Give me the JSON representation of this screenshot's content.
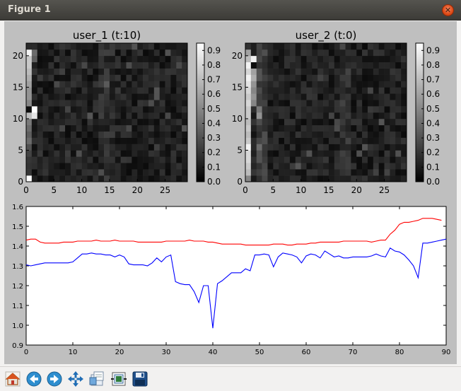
{
  "window": {
    "title": "Figure 1"
  },
  "toolbar": {
    "buttons": [
      {
        "name": "home-icon"
      },
      {
        "name": "back-icon"
      },
      {
        "name": "forward-icon"
      },
      {
        "name": "pan-icon"
      },
      {
        "name": "zoom-icon"
      },
      {
        "name": "configure-subplots-icon"
      },
      {
        "name": "save-icon"
      }
    ]
  },
  "chart_data": [
    {
      "type": "heatmap",
      "title": "user_1 (t:10)",
      "rows": 22,
      "cols": 29,
      "colormap": "gray",
      "xticks": [
        "0",
        "5",
        "10",
        "15",
        "20",
        "25"
      ],
      "yticks": [
        "0",
        "5",
        "10",
        "15",
        "20"
      ],
      "colorbar": {
        "ticks": [
          "0.0",
          "0.1",
          "0.2",
          "0.3",
          "0.4",
          "0.5",
          "0.6",
          "0.7",
          "0.8",
          "0.9"
        ],
        "range": [
          0,
          0.95
        ]
      },
      "salient_cells": [
        {
          "x": 0,
          "y": 20,
          "value": 0.9
        },
        {
          "x": 0,
          "y": 19,
          "value": 0.75
        },
        {
          "x": 0,
          "y": 18,
          "value": 0.75
        },
        {
          "x": 0,
          "y": 17,
          "value": 0.7
        },
        {
          "x": 0,
          "y": 16,
          "value": 0.65
        },
        {
          "x": 0,
          "y": 15,
          "value": 0.6
        },
        {
          "x": 0,
          "y": 14,
          "value": 0.55
        },
        {
          "x": 0,
          "y": 13,
          "value": 0.55
        },
        {
          "x": 0,
          "y": 12,
          "value": 0.5
        },
        {
          "x": 0,
          "y": 11,
          "value": 0.05
        },
        {
          "x": 1,
          "y": 11,
          "value": 0.95
        },
        {
          "x": 0,
          "y": 10,
          "value": 0.7
        },
        {
          "x": 1,
          "y": 10,
          "value": 0.85
        },
        {
          "x": 0,
          "y": 9,
          "value": 0.45
        },
        {
          "x": 0,
          "y": 8,
          "value": 0.4
        },
        {
          "x": 0,
          "y": 7,
          "value": 0.35
        },
        {
          "x": 0,
          "y": 6,
          "value": 0.4
        },
        {
          "x": 0,
          "y": 5,
          "value": 0.3
        },
        {
          "x": 0,
          "y": 4,
          "value": 0.25
        },
        {
          "x": 0,
          "y": 3,
          "value": 0.2
        },
        {
          "x": 0,
          "y": 1,
          "value": 0.2
        },
        {
          "x": 0,
          "y": 0,
          "value": 0.95
        },
        {
          "x": 1,
          "y": 20,
          "value": 0.4
        },
        {
          "x": 1,
          "y": 19,
          "value": 0.35
        }
      ]
    },
    {
      "type": "heatmap",
      "title": "user_2 (t:0)",
      "rows": 22,
      "cols": 29,
      "colormap": "gray",
      "xticks": [
        "0",
        "5",
        "10",
        "15",
        "20",
        "25"
      ],
      "yticks": [
        "0",
        "5",
        "10",
        "15",
        "20"
      ],
      "colorbar": {
        "ticks": [
          "0.0",
          "0.1",
          "0.2",
          "0.3",
          "0.4",
          "0.5",
          "0.6",
          "0.7",
          "0.8",
          "0.9"
        ],
        "range": [
          0,
          0.95
        ]
      },
      "salient_cells": [
        {
          "x": 0,
          "y": 20,
          "value": 0.6
        },
        {
          "x": 0,
          "y": 19,
          "value": 0.7
        },
        {
          "x": 0,
          "y": 18,
          "value": 0.9
        },
        {
          "x": 0,
          "y": 17,
          "value": 0.8
        },
        {
          "x": 0,
          "y": 16,
          "value": 0.9
        },
        {
          "x": 0,
          "y": 15,
          "value": 0.85
        },
        {
          "x": 0,
          "y": 14,
          "value": 0.8
        },
        {
          "x": 0,
          "y": 13,
          "value": 0.75
        },
        {
          "x": 0,
          "y": 12,
          "value": 0.8
        },
        {
          "x": 0,
          "y": 11,
          "value": 0.75
        },
        {
          "x": 0,
          "y": 10,
          "value": 0.75
        },
        {
          "x": 0,
          "y": 9,
          "value": 0.7
        },
        {
          "x": 0,
          "y": 8,
          "value": 0.75
        },
        {
          "x": 0,
          "y": 7,
          "value": 0.7
        },
        {
          "x": 0,
          "y": 6,
          "value": 0.75
        },
        {
          "x": 0,
          "y": 5,
          "value": 0.9
        },
        {
          "x": 0,
          "y": 4,
          "value": 0.8
        },
        {
          "x": 0,
          "y": 3,
          "value": 0.8
        },
        {
          "x": 0,
          "y": 2,
          "value": 0.75
        },
        {
          "x": 0,
          "y": 1,
          "value": 0.7
        },
        {
          "x": 0,
          "y": 0,
          "value": 0.5
        },
        {
          "x": 1,
          "y": 19,
          "value": 0.9
        },
        {
          "x": 1,
          "y": 18,
          "value": 0.05
        },
        {
          "x": 1,
          "y": 17,
          "value": 0.6
        },
        {
          "x": 1,
          "y": 16,
          "value": 0.65
        },
        {
          "x": 1,
          "y": 15,
          "value": 0.55
        },
        {
          "x": 1,
          "y": 14,
          "value": 0.5
        },
        {
          "x": 1,
          "y": 13,
          "value": 0.55
        },
        {
          "x": 1,
          "y": 12,
          "value": 0.5
        },
        {
          "x": 2,
          "y": 10,
          "value": 0.55
        },
        {
          "x": 2,
          "y": 11,
          "value": 0.45
        },
        {
          "x": 2,
          "y": 5,
          "value": 0.4
        }
      ]
    },
    {
      "type": "line",
      "xlim": [
        0,
        90
      ],
      "ylim": [
        0.9,
        1.6
      ],
      "xticks": [
        "0",
        "10",
        "20",
        "30",
        "40",
        "50",
        "60",
        "70",
        "80",
        "90"
      ],
      "yticks": [
        "0.9",
        "1.0",
        "1.1",
        "1.2",
        "1.3",
        "1.4",
        "1.5",
        "1.6"
      ],
      "series": [
        {
          "color": "#ff0000",
          "points": [
            [
              0,
              1.43
            ],
            [
              1,
              1.435
            ],
            [
              2,
              1.435
            ],
            [
              3,
              1.42
            ],
            [
              4,
              1.415
            ],
            [
              5,
              1.415
            ],
            [
              6,
              1.415
            ],
            [
              7,
              1.415
            ],
            [
              8,
              1.42
            ],
            [
              9,
              1.42
            ],
            [
              10,
              1.42
            ],
            [
              11,
              1.425
            ],
            [
              12,
              1.425
            ],
            [
              13,
              1.425
            ],
            [
              14,
              1.425
            ],
            [
              15,
              1.43
            ],
            [
              16,
              1.425
            ],
            [
              17,
              1.425
            ],
            [
              18,
              1.425
            ],
            [
              19,
              1.43
            ],
            [
              20,
              1.425
            ],
            [
              21,
              1.425
            ],
            [
              22,
              1.425
            ],
            [
              23,
              1.425
            ],
            [
              24,
              1.42
            ],
            [
              25,
              1.42
            ],
            [
              26,
              1.42
            ],
            [
              27,
              1.42
            ],
            [
              28,
              1.42
            ],
            [
              29,
              1.42
            ],
            [
              30,
              1.425
            ],
            [
              31,
              1.425
            ],
            [
              32,
              1.425
            ],
            [
              33,
              1.425
            ],
            [
              34,
              1.425
            ],
            [
              35,
              1.43
            ],
            [
              36,
              1.425
            ],
            [
              37,
              1.425
            ],
            [
              38,
              1.425
            ],
            [
              39,
              1.42
            ],
            [
              40,
              1.42
            ],
            [
              41,
              1.415
            ],
            [
              42,
              1.41
            ],
            [
              43,
              1.41
            ],
            [
              44,
              1.41
            ],
            [
              45,
              1.41
            ],
            [
              46,
              1.41
            ],
            [
              47,
              1.405
            ],
            [
              48,
              1.405
            ],
            [
              49,
              1.405
            ],
            [
              50,
              1.405
            ],
            [
              51,
              1.405
            ],
            [
              52,
              1.405
            ],
            [
              53,
              1.41
            ],
            [
              54,
              1.41
            ],
            [
              55,
              1.41
            ],
            [
              56,
              1.405
            ],
            [
              57,
              1.405
            ],
            [
              58,
              1.41
            ],
            [
              59,
              1.41
            ],
            [
              60,
              1.41
            ],
            [
              61,
              1.415
            ],
            [
              62,
              1.415
            ],
            [
              63,
              1.42
            ],
            [
              64,
              1.42
            ],
            [
              65,
              1.42
            ],
            [
              66,
              1.42
            ],
            [
              67,
              1.42
            ],
            [
              68,
              1.425
            ],
            [
              69,
              1.425
            ],
            [
              70,
              1.425
            ],
            [
              71,
              1.425
            ],
            [
              72,
              1.425
            ],
            [
              73,
              1.425
            ],
            [
              74,
              1.42
            ],
            [
              75,
              1.425
            ],
            [
              76,
              1.43
            ],
            [
              77,
              1.43
            ],
            [
              78,
              1.46
            ],
            [
              79,
              1.48
            ],
            [
              80,
              1.51
            ],
            [
              81,
              1.52
            ],
            [
              82,
              1.52
            ],
            [
              83,
              1.525
            ],
            [
              84,
              1.53
            ],
            [
              85,
              1.54
            ],
            [
              86,
              1.54
            ],
            [
              87,
              1.54
            ],
            [
              88,
              1.535
            ],
            [
              89,
              1.53
            ]
          ]
        },
        {
          "color": "#0000ff",
          "points": [
            [
              0,
              1.305
            ],
            [
              1,
              1.3
            ],
            [
              2,
              1.305
            ],
            [
              3,
              1.31
            ],
            [
              4,
              1.315
            ],
            [
              5,
              1.315
            ],
            [
              6,
              1.315
            ],
            [
              7,
              1.315
            ],
            [
              8,
              1.315
            ],
            [
              9,
              1.315
            ],
            [
              10,
              1.32
            ],
            [
              11,
              1.34
            ],
            [
              12,
              1.36
            ],
            [
              13,
              1.36
            ],
            [
              14,
              1.365
            ],
            [
              15,
              1.36
            ],
            [
              16,
              1.36
            ],
            [
              17,
              1.355
            ],
            [
              18,
              1.355
            ],
            [
              19,
              1.345
            ],
            [
              20,
              1.355
            ],
            [
              21,
              1.345
            ],
            [
              22,
              1.31
            ],
            [
              23,
              1.305
            ],
            [
              24,
              1.305
            ],
            [
              25,
              1.305
            ],
            [
              26,
              1.3
            ],
            [
              27,
              1.315
            ],
            [
              28,
              1.34
            ],
            [
              29,
              1.32
            ],
            [
              30,
              1.345
            ],
            [
              31,
              1.355
            ],
            [
              32,
              1.22
            ],
            [
              33,
              1.21
            ],
            [
              34,
              1.205
            ],
            [
              35,
              1.205
            ],
            [
              36,
              1.17
            ],
            [
              37,
              1.115
            ],
            [
              38,
              1.2
            ],
            [
              39,
              1.2
            ],
            [
              40,
              0.985
            ],
            [
              41,
              1.21
            ],
            [
              42,
              1.225
            ],
            [
              43,
              1.245
            ],
            [
              44,
              1.265
            ],
            [
              45,
              1.265
            ],
            [
              46,
              1.265
            ],
            [
              47,
              1.285
            ],
            [
              48,
              1.275
            ],
            [
              49,
              1.355
            ],
            [
              50,
              1.355
            ],
            [
              51,
              1.36
            ],
            [
              52,
              1.355
            ],
            [
              53,
              1.295
            ],
            [
              54,
              1.345
            ],
            [
              55,
              1.365
            ],
            [
              56,
              1.36
            ],
            [
              57,
              1.355
            ],
            [
              58,
              1.345
            ],
            [
              59,
              1.315
            ],
            [
              60,
              1.35
            ],
            [
              61,
              1.36
            ],
            [
              62,
              1.355
            ],
            [
              63,
              1.34
            ],
            [
              64,
              1.375
            ],
            [
              65,
              1.36
            ],
            [
              66,
              1.345
            ],
            [
              67,
              1.35
            ],
            [
              68,
              1.34
            ],
            [
              69,
              1.34
            ],
            [
              70,
              1.345
            ],
            [
              71,
              1.345
            ],
            [
              72,
              1.345
            ],
            [
              73,
              1.345
            ],
            [
              74,
              1.35
            ],
            [
              75,
              1.36
            ],
            [
              76,
              1.35
            ],
            [
              77,
              1.345
            ],
            [
              78,
              1.39
            ],
            [
              79,
              1.375
            ],
            [
              80,
              1.37
            ],
            [
              81,
              1.355
            ],
            [
              82,
              1.33
            ],
            [
              83,
              1.3
            ],
            [
              84,
              1.24
            ],
            [
              85,
              1.415
            ],
            [
              86,
              1.415
            ],
            [
              87,
              1.42
            ],
            [
              88,
              1.425
            ],
            [
              89,
              1.43
            ],
            [
              90,
              1.435
            ]
          ]
        }
      ]
    }
  ]
}
